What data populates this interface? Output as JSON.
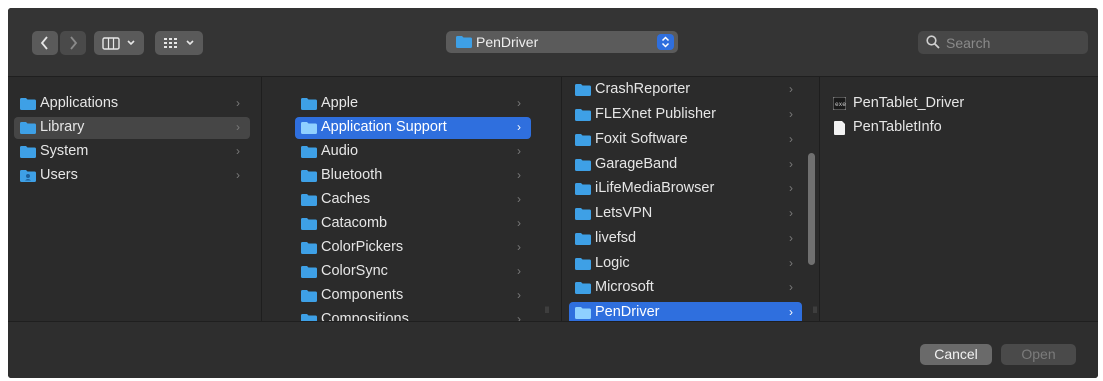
{
  "toolbar": {
    "path_popup": "PenDriver",
    "search_placeholder": "Search"
  },
  "columns": [
    {
      "items": [
        {
          "label": "Applications",
          "state": "normal",
          "icon": "folder-icon"
        },
        {
          "label": "Library",
          "state": "selected-inactive",
          "icon": "folder-icon"
        },
        {
          "label": "System",
          "state": "normal",
          "icon": "folder-icon"
        },
        {
          "label": "Users",
          "state": "normal",
          "icon": "users-folder-icon"
        }
      ]
    },
    {
      "items": [
        {
          "label": "Apple",
          "state": "normal"
        },
        {
          "label": "Application Support",
          "state": "selected"
        },
        {
          "label": "Audio",
          "state": "normal"
        },
        {
          "label": "Bluetooth",
          "state": "normal"
        },
        {
          "label": "Caches",
          "state": "normal"
        },
        {
          "label": "Catacomb",
          "state": "normal"
        },
        {
          "label": "ColorPickers",
          "state": "normal"
        },
        {
          "label": "ColorSync",
          "state": "normal"
        },
        {
          "label": "Components",
          "state": "normal"
        },
        {
          "label": "Compositions",
          "state": "normal"
        }
      ]
    },
    {
      "items": [
        {
          "label": "CrashReporter",
          "state": "normal"
        },
        {
          "label": "FLEXnet Publisher",
          "state": "normal"
        },
        {
          "label": "Foxit Software",
          "state": "normal"
        },
        {
          "label": "GarageBand",
          "state": "normal"
        },
        {
          "label": "iLifeMediaBrowser",
          "state": "normal"
        },
        {
          "label": "LetsVPN",
          "state": "normal"
        },
        {
          "label": "livefsd",
          "state": "normal"
        },
        {
          "label": "Logic",
          "state": "normal"
        },
        {
          "label": "Microsoft",
          "state": "normal"
        },
        {
          "label": "PenDriver",
          "state": "selected"
        }
      ]
    },
    {
      "items": [
        {
          "label": "PenTablet_Driver",
          "state": "normal",
          "icon": "executable-icon"
        },
        {
          "label": "PenTabletInfo",
          "state": "normal",
          "icon": "document-icon"
        }
      ]
    }
  ],
  "footer": {
    "cancel_label": "Cancel",
    "open_label": "Open"
  },
  "colors": {
    "selection": "#2f6fde",
    "folder": "#3ea0e6",
    "background": "#2b2b2b"
  }
}
